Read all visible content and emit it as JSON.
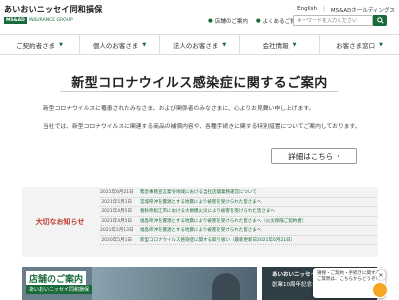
{
  "header": {
    "logo_title": "あいおいニッセイ同和損保",
    "logo_badge": "MS&AD",
    "logo_group": "INSURANCE GROUP",
    "top_links": [
      "English",
      "MS&ADホールディングス"
    ],
    "sub_links": [
      "店舗のご案内",
      "よくあるご質問",
      "ご"
    ],
    "search_placeholder": "キーワードを入力ください"
  },
  "nav": {
    "items": [
      "ご契約者さま",
      "個人のお客さま",
      "法人のお客さま",
      "会社情報",
      "お客さま窓口"
    ]
  },
  "notice": {
    "title": "新型コロナウイルス感染症に関するご案内",
    "para1": "新型コロナウイルスに罹患されたみなさま、および関係者のみなさまに、心よりお見舞い申し上げます。",
    "para2": "当社では、新型コロナウイルスに関連する商品の補償内容や、各種手続きに関する特別措置についてご案内しております。",
    "detail_button": "詳細はこちら"
  },
  "important": {
    "label": "大切なお知らせ",
    "rows": [
      {
        "date": "2021年6月21日",
        "text": "緊急事態宣言発令地域における当社店舗業務運営について"
      },
      {
        "date": "2021年5月1日",
        "text": "宮城県沖を震源とする地震により被害を受けられた皆さまへ"
      },
      {
        "date": "2021年4月5日",
        "text": "春秋県松江市における大規模火災により被害を受けられた皆さまへ"
      },
      {
        "date": "2021年4月5日",
        "text": "福島県沖を震源とする地震により被害を受けられた皆さまへ（火災保険ご契約者）"
      },
      {
        "date": "2021年2月13日",
        "text": "福島県沖を震源とする地震により被害を受けられた皆さまへ"
      },
      {
        "date": "2020年5月1日",
        "text": "新型コロナウイルス感染症に関する取り扱い（最新更新日2021年6月21日）"
      }
    ]
  },
  "banners": {
    "left_title": "店舗のご案内",
    "left_sub": "あいおいニッセイ同和損保",
    "right_line1": "あいおいニッセイ同和損保株式",
    "right_line2": "創業10周年記念企画"
  },
  "chat": {
    "text": "損保・ご契約・手続きに関するご質問は、こちらからどうぞ！"
  },
  "colors": {
    "brand_green": "#1a6b3b",
    "alert_red": "#c0392b"
  }
}
